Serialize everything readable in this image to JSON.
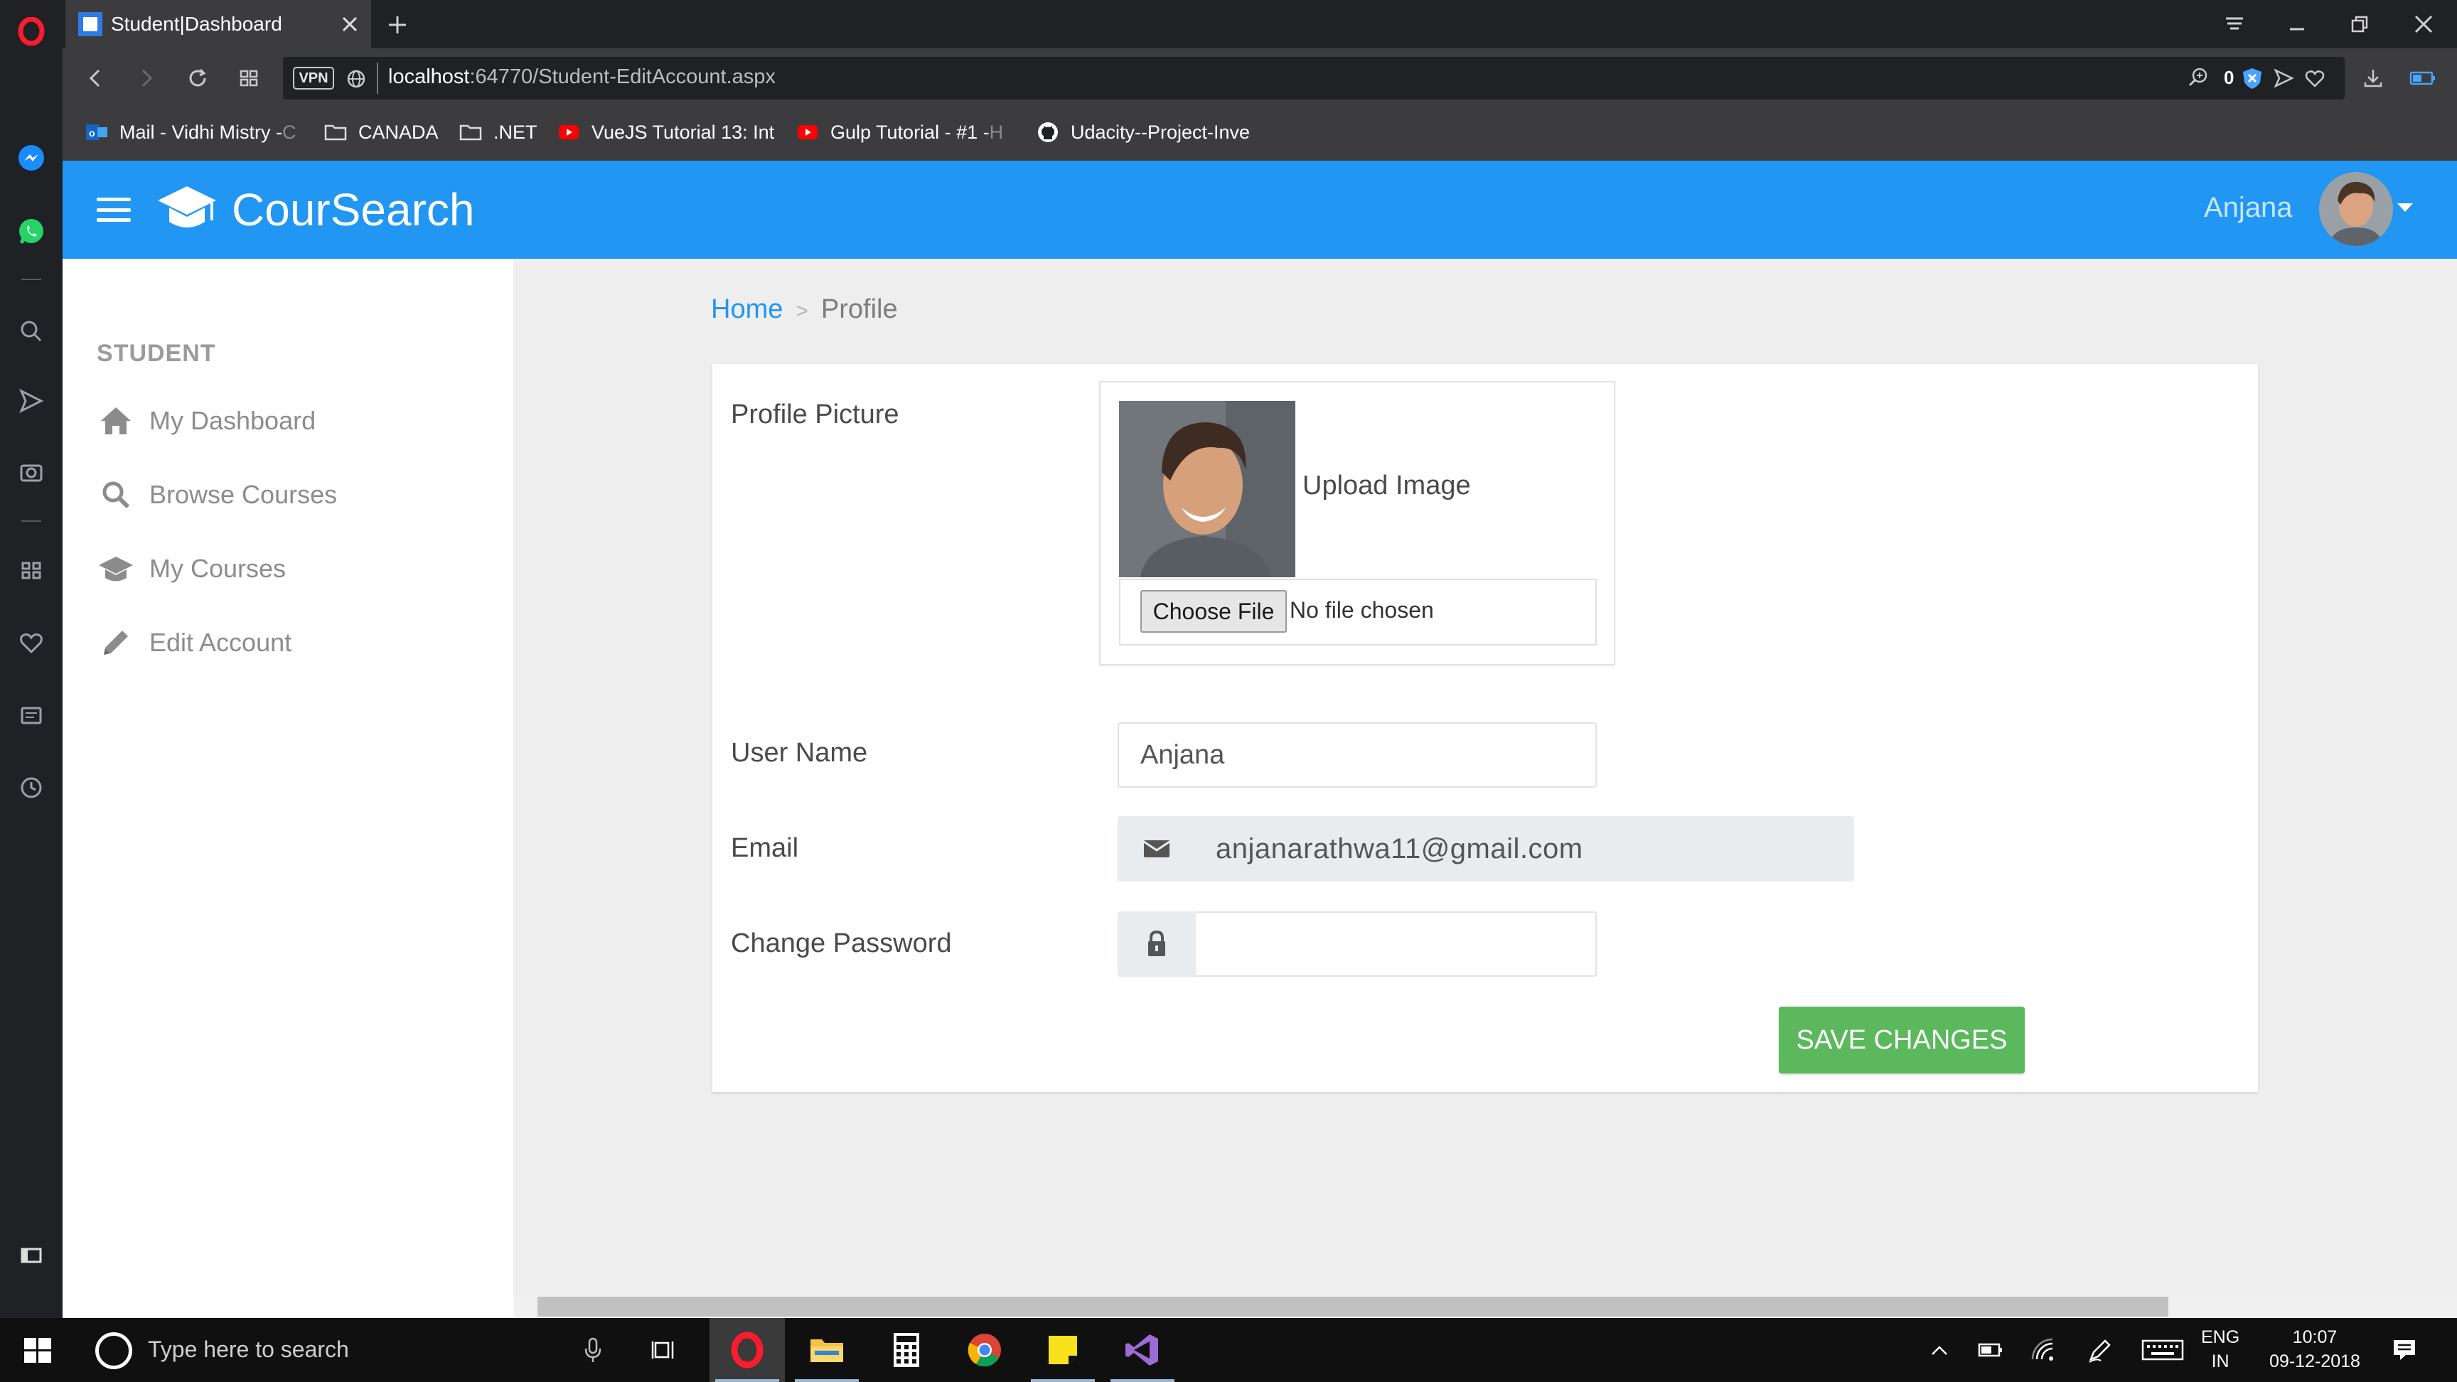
{
  "browser": {
    "tab_title": "Student|Dashboard",
    "url_host": "localhost",
    "url_path": ":64770/Student-EditAccount.aspx",
    "vpn_label": "VPN",
    "adblock_count": "0",
    "bookmarks": [
      {
        "label": "Mail - Vidhi Mistry - ",
        "fade": "C",
        "icon": "outlook-icon"
      },
      {
        "label": "CANADA",
        "fade": "",
        "icon": "folder-icon"
      },
      {
        "label": ".NET",
        "fade": "",
        "icon": "folder-icon"
      },
      {
        "label": "VueJS Tutorial 13: Int",
        "fade": "",
        "icon": "youtube-icon"
      },
      {
        "label": "Gulp Tutorial - #1 - ",
        "fade": "H",
        "icon": "youtube-icon"
      },
      {
        "label": "Udacity--Project-Inve",
        "fade": "",
        "icon": "github-icon"
      }
    ]
  },
  "app": {
    "brand": "CourSearch",
    "user_name": "Anjana"
  },
  "sidebar": {
    "heading": "STUDENT",
    "items": [
      {
        "label": "My Dashboard",
        "icon": "home-icon"
      },
      {
        "label": "Browse Courses",
        "icon": "search-icon"
      },
      {
        "label": "My Courses",
        "icon": "graduation-cap-icon"
      },
      {
        "label": "Edit Account",
        "icon": "pencil-icon"
      }
    ]
  },
  "breadcrumb": {
    "home": "Home",
    "separator": ">",
    "current": "Profile"
  },
  "form": {
    "profile_picture_label": "Profile Picture",
    "upload_label": "Upload Image",
    "choose_file_button": "Choose File",
    "no_file_text": "No file chosen",
    "username_label": "User Name",
    "username_value": "Anjana",
    "email_label": "Email",
    "email_value": "anjanarathwa11@gmail.com",
    "password_label": "Change Password",
    "password_value": "",
    "save_button": "SAVE CHANGES"
  },
  "taskbar": {
    "search_placeholder": "Type here to search",
    "lang_line1": "ENG",
    "lang_line2": "IN",
    "time": "10:07",
    "date": "09-12-2018"
  },
  "colors": {
    "header_blue": "#2196f3",
    "save_green": "#5cb85c",
    "breadcrumb_link": "#2196f3"
  }
}
